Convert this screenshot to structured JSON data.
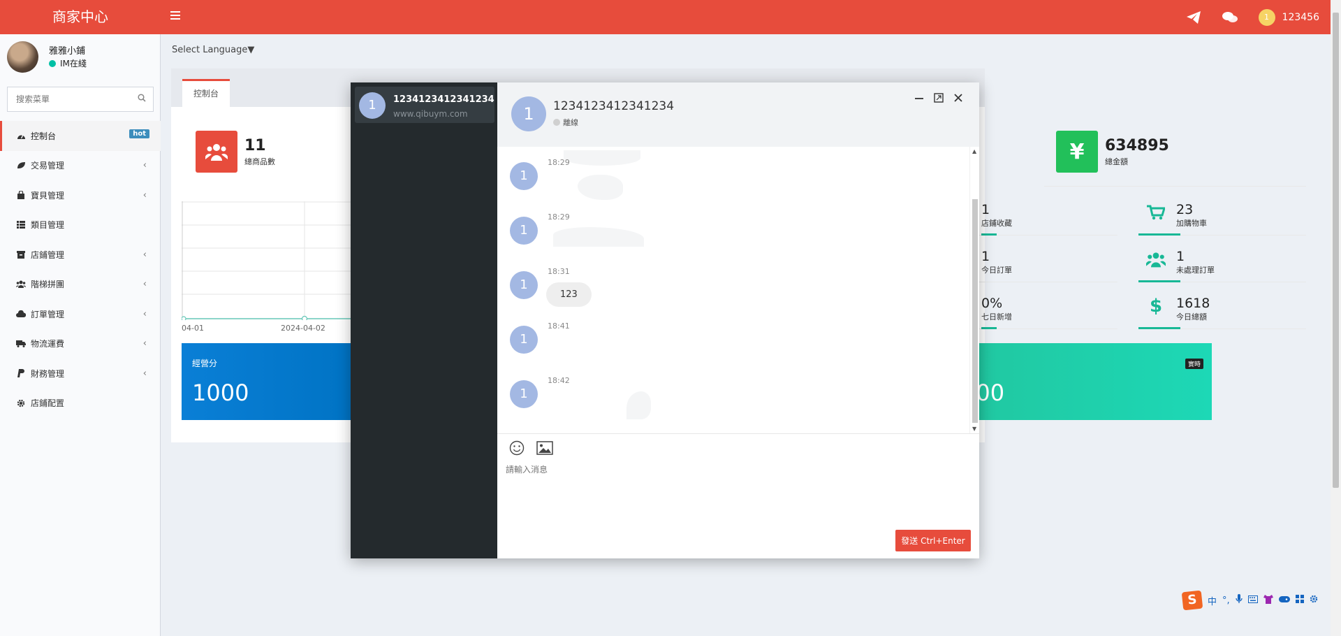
{
  "topbar": {
    "brand": "商家中心",
    "toggle_icon": "menu-icon",
    "user_avatar_initial": "1",
    "username": "123456",
    "accent": "#e74c3c"
  },
  "sidebar": {
    "user_name": "雅雅小鋪",
    "user_status": "IM在綫",
    "search_placeholder": "搜索菜單",
    "items": [
      {
        "label": "控制台",
        "icon": "dashboard-icon",
        "badge": "hot",
        "chevron": ""
      },
      {
        "label": "交易管理",
        "icon": "leaf-icon",
        "chevron": "‹"
      },
      {
        "label": "寶貝管理",
        "icon": "shopping-bag-icon",
        "chevron": "‹"
      },
      {
        "label": "類目管理",
        "icon": "list-icon",
        "chevron": ""
      },
      {
        "label": "店鋪管理",
        "icon": "archive-icon",
        "chevron": "‹"
      },
      {
        "label": "階梯拼團",
        "icon": "users-icon",
        "chevron": "‹"
      },
      {
        "label": "訂單管理",
        "icon": "cloud-icon",
        "chevron": "‹"
      },
      {
        "label": "物流運費",
        "icon": "truck-icon",
        "chevron": "‹"
      },
      {
        "label": "財務管理",
        "icon": "paypal-icon",
        "chevron": "‹"
      },
      {
        "label": "店鋪配置",
        "icon": "gear-icon",
        "chevron": ""
      }
    ]
  },
  "main": {
    "language": "Select Language▼",
    "tab": "控制台",
    "stats": [
      {
        "value": "11",
        "label": "總商品數",
        "color": "#e74c3c"
      },
      {
        "value": "634895",
        "label": "總金額",
        "color": "#22c05a"
      }
    ],
    "kpis": [
      {
        "value": "1",
        "label": "店鋪收藏"
      },
      {
        "value": "23",
        "label": "加購物車"
      },
      {
        "value": "1",
        "label": "今日訂單"
      },
      {
        "value": "1",
        "label": "未處理訂單"
      },
      {
        "value": "0%",
        "label": "七日新增"
      },
      {
        "value": "1618",
        "label": "今日總額"
      }
    ],
    "chart_x_labels": [
      "04-01",
      "2024-04-02"
    ],
    "score_title": "經營分",
    "score_value": "1000",
    "green_value": "000",
    "green_badge": "實時"
  },
  "chat": {
    "conversation": {
      "avatar": "1",
      "name": "1234123412341234",
      "site": "www.qibuym.com"
    },
    "header": {
      "avatar": "1",
      "name": "1234123412341234",
      "status": "離線"
    },
    "messages": [
      {
        "avatar": "1",
        "time": "18:29",
        "text": ""
      },
      {
        "avatar": "1",
        "time": "18:29",
        "text": ""
      },
      {
        "avatar": "1",
        "time": "18:31",
        "text": "123"
      },
      {
        "avatar": "1",
        "time": "18:41",
        "text": ""
      },
      {
        "avatar": "1",
        "time": "18:42",
        "text": ""
      }
    ],
    "input_placeholder": "請輸入消息",
    "send_label": "發送 Ctrl+Enter"
  },
  "ime": {
    "logo": "S",
    "mode": "中",
    "punct": "°,"
  }
}
